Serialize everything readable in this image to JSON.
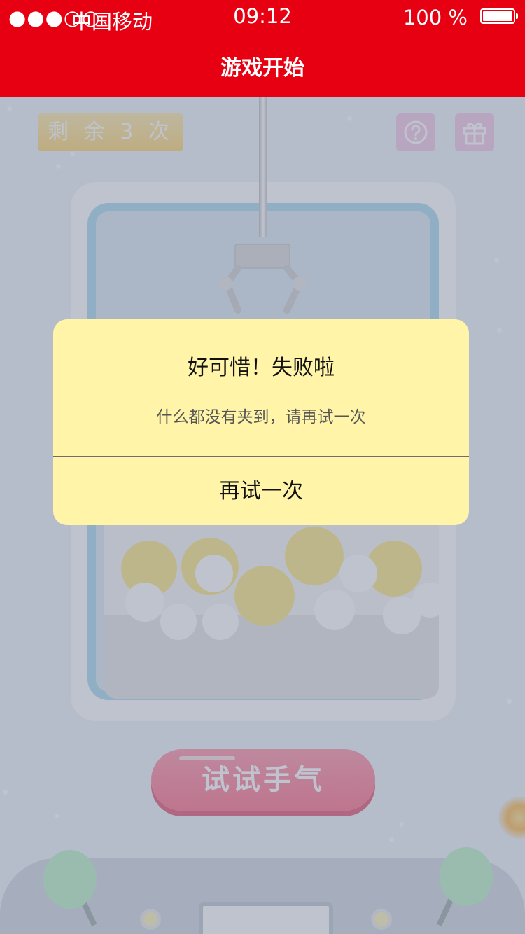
{
  "status_bar": {
    "signal": "●●●○○",
    "carrier": "中国移动",
    "time": "09:12",
    "battery": "100 %"
  },
  "header": {
    "title": "游戏开始"
  },
  "game": {
    "remaining_label": "剩 余 3 次",
    "help_icon": "question-circle-icon",
    "gift_icon": "gift-icon",
    "play_button": "试试手气"
  },
  "dialog": {
    "title": "好可惜！失败啦",
    "message": "什么都没有夹到，请再试一次",
    "action": "再试一次"
  },
  "colors": {
    "header_red": "#e60012",
    "dialog_bg": "#fff4a8",
    "play_pink": "#ff6b86",
    "remaining_gold": "#ffd36e"
  }
}
